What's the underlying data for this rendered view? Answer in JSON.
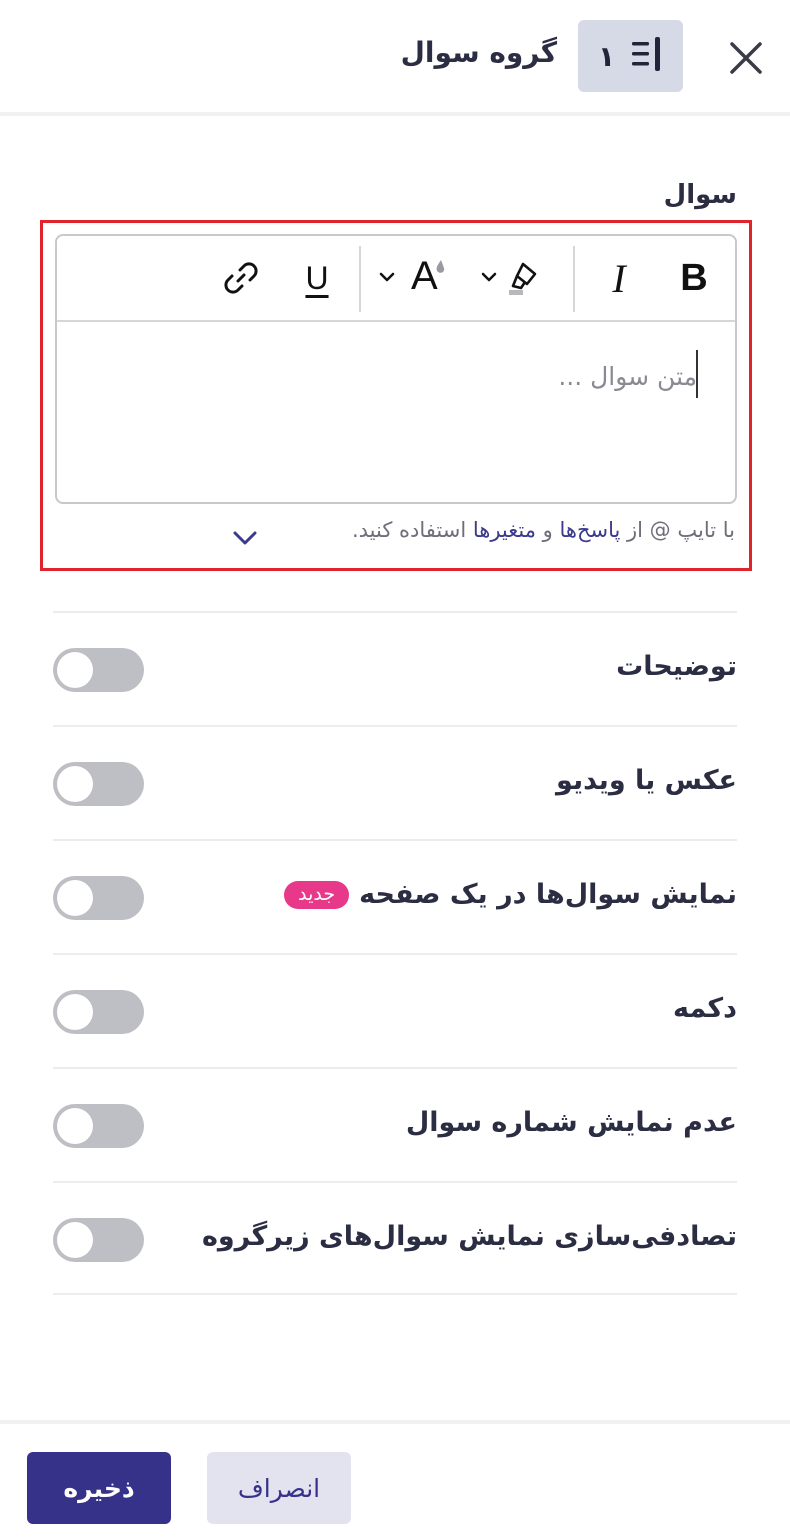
{
  "header": {
    "title": "گروه سوال",
    "type_number": "۱",
    "close_icon": "close-icon",
    "type_icon": "question-group-icon"
  },
  "question": {
    "label": "سوال",
    "placeholder": "متن سوال ...",
    "toolbar": {
      "bold": "B",
      "italic": "I",
      "underline": "U",
      "font_color": "A",
      "icons": [
        "bold-icon",
        "italic-icon",
        "highlight-color-icon",
        "font-color-icon",
        "underline-icon",
        "link-icon"
      ]
    },
    "hint": {
      "prefix": "با تایپ @ از ",
      "link1": "پاسخ‌ها",
      "middle": " و ",
      "link2": "متغیرها",
      "suffix": " استفاده کنید."
    }
  },
  "options": [
    {
      "label": "توضیحات",
      "enabled": false
    },
    {
      "label": "عکس یا ویدیو",
      "enabled": false
    },
    {
      "label": "نمایش سوال‌ها در یک صفحه",
      "badge": "جدید",
      "enabled": false
    },
    {
      "label": "دکمه",
      "enabled": false
    },
    {
      "label": "عدم نمایش شماره سوال",
      "enabled": false
    },
    {
      "label": "تصادفی‌سازی نمایش سوال‌های زیرگروه",
      "enabled": false
    }
  ],
  "footer": {
    "save_label": "ذخیره",
    "cancel_label": "انصراف"
  },
  "colors": {
    "primary": "#363289",
    "badge": "#e8388a",
    "highlight_border": "#e0242c",
    "toggle_off": "#bebfc4"
  }
}
